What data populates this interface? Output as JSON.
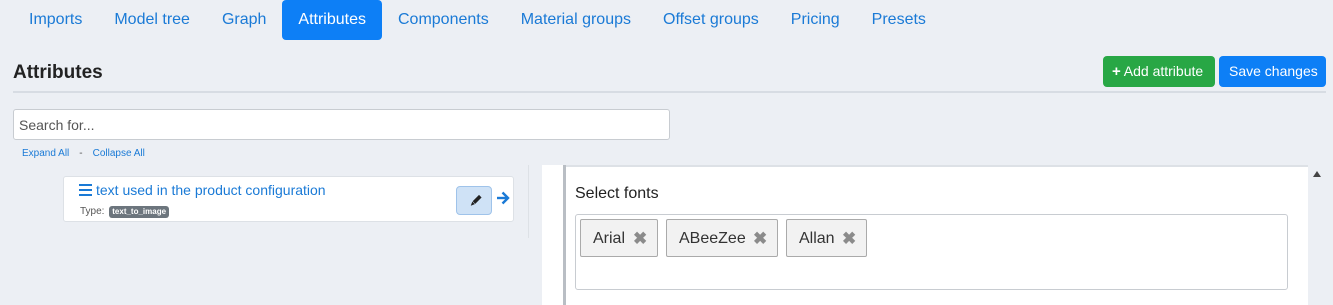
{
  "tabs": [
    {
      "label": "Imports",
      "active": false
    },
    {
      "label": "Model tree",
      "active": false
    },
    {
      "label": "Graph",
      "active": false
    },
    {
      "label": "Attributes",
      "active": true
    },
    {
      "label": "Components",
      "active": false
    },
    {
      "label": "Material groups",
      "active": false
    },
    {
      "label": "Offset groups",
      "active": false
    },
    {
      "label": "Pricing",
      "active": false
    },
    {
      "label": "Presets",
      "active": false
    }
  ],
  "header": {
    "title": "Attributes",
    "add_button": {
      "icon": "plus-icon",
      "label": "Add attribute"
    },
    "save_button": {
      "label": "Save changes"
    }
  },
  "search": {
    "placeholder": "Search for...",
    "value": ""
  },
  "tree_controls": {
    "expand_all": "Expand All",
    "separator": "-",
    "collapse_all": "Collapse All"
  },
  "tree_item": {
    "icon": "hamburger-icon",
    "label": "text used in the product configuration",
    "type_label": "Type:",
    "type_value": "text_to_image",
    "edit_icon": "pencil-icon",
    "open_icon": "arrow-right-icon"
  },
  "panel": {
    "label": "Select fonts",
    "selected_fonts": [
      "Arial",
      "ABeeZee",
      "Allan"
    ],
    "remove_icon": "close-icon"
  },
  "colors": {
    "primary": "#0d7ff6",
    "success": "#28a745",
    "link": "#1a7ad6",
    "background": "#eceff4"
  }
}
